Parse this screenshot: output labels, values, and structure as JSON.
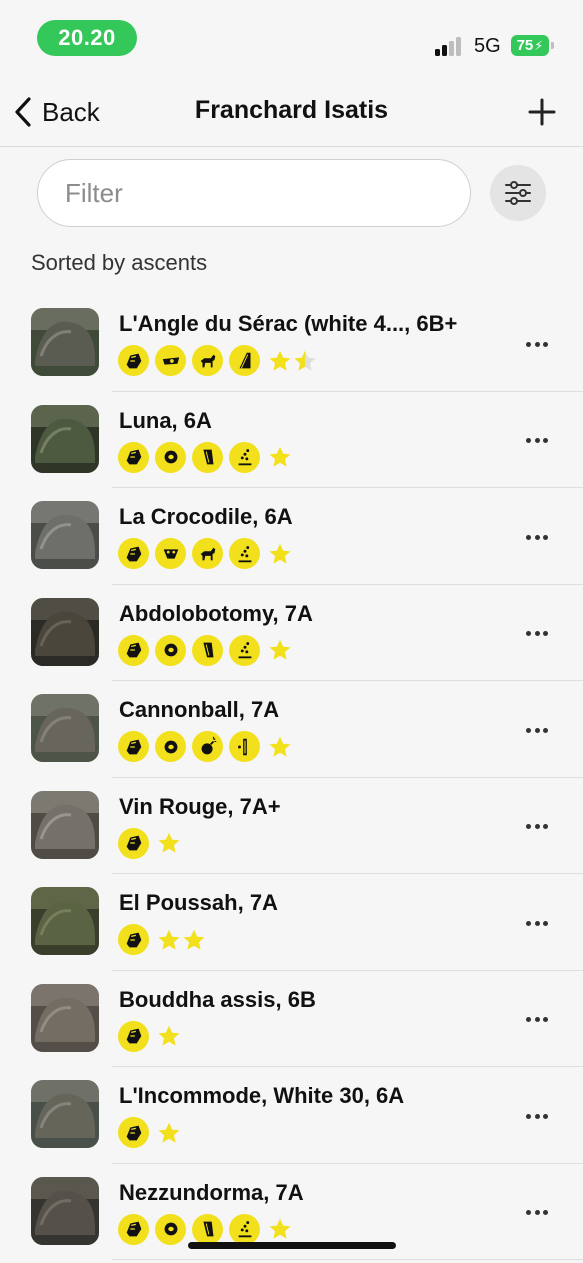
{
  "status_bar": {
    "time": "20.20",
    "network": "5G",
    "battery": "75"
  },
  "nav": {
    "back_label": "Back",
    "title": "Franchard Isatis"
  },
  "filter": {
    "placeholder": "Filter"
  },
  "sort_label": "Sorted by ascents",
  "colors": {
    "badge": "#f2e01c",
    "star": "#f2e01c",
    "status_green": "#34c759"
  },
  "problems": [
    {
      "title": "L'Angle du Sérac (white 4..., 6B+",
      "badges": [
        "rock-icon",
        "pinch-hold-icon",
        "dog-icon",
        "arete-icon"
      ],
      "stars": 1.5,
      "thumb": [
        "#8a8a80",
        "#5a5c52",
        "#3f4a38"
      ]
    },
    {
      "title": "Luna, 6A",
      "badges": [
        "rock-icon",
        "pocket-icon",
        "wall-icon",
        "slab-icon"
      ],
      "stars": 1,
      "thumb": [
        "#7f8a6a",
        "#4e5a40",
        "#2f3628"
      ]
    },
    {
      "title": "La Crocodile, 6A",
      "badges": [
        "rock-icon",
        "crocodile-face-icon",
        "dog-icon",
        "slab-icon"
      ],
      "stars": 1,
      "thumb": [
        "#9a9a96",
        "#6e6e6a",
        "#4a4d48"
      ]
    },
    {
      "title": "Abdolobotomy, 7A",
      "badges": [
        "rock-icon",
        "pocket-icon",
        "wall-icon",
        "slab-icon"
      ],
      "stars": 1,
      "thumb": [
        "#6e6a5e",
        "#4a463c",
        "#2c2a24"
      ]
    },
    {
      "title": "Cannonball, 7A",
      "badges": [
        "rock-icon",
        "pocket-icon",
        "bomb-icon",
        "crack-icon"
      ],
      "stars": 1,
      "thumb": [
        "#8c8a80",
        "#67655c",
        "#4d5448"
      ]
    },
    {
      "title": "Vin Rouge, 7A+",
      "badges": [
        "rock-icon"
      ],
      "stars": 1,
      "thumb": [
        "#a29e96",
        "#75716a",
        "#4f4c46"
      ]
    },
    {
      "title": "El Poussah, 7A",
      "badges": [
        "rock-icon"
      ],
      "stars": 2,
      "thumb": [
        "#7d8660",
        "#5a6344",
        "#3a3f2c"
      ]
    },
    {
      "title": "Bouddha assis, 6B",
      "badges": [
        "rock-icon"
      ],
      "stars": 1,
      "thumb": [
        "#9a948a",
        "#736d64",
        "#534e48"
      ]
    },
    {
      "title": "L'Incommode, White 30, 6A",
      "badges": [
        "rock-icon"
      ],
      "stars": 1,
      "thumb": [
        "#8e8c84",
        "#66655a",
        "#49504a"
      ]
    },
    {
      "title": "Nezzundorma, 7A",
      "badges": [
        "rock-icon",
        "pocket-icon",
        "wall-icon",
        "slab-icon"
      ],
      "stars": 1,
      "thumb": [
        "#78746a",
        "#55514a",
        "#363430"
      ]
    }
  ]
}
